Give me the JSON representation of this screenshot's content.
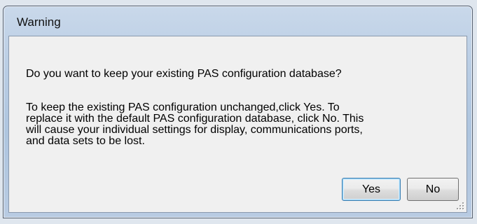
{
  "window": {
    "title": "Warning"
  },
  "dialog": {
    "question": "Do you want to keep your existing PAS configuration database?",
    "body_lines": [
      "To keep the existing PAS configuration unchanged,click Yes. To",
      "replace it with the default PAS configuration database, click No. This",
      "will cause your individual settings for display, communications ports,",
      "and data sets to be lost."
    ]
  },
  "buttons": {
    "yes_label": "Yes",
    "no_label": "No"
  },
  "icons": {
    "resize_grip": "resize-grip-icon"
  },
  "colors": {
    "title_bar": "#b9cde4",
    "dialog_background": "#f0f0f0",
    "default_button_border": "#3c7fb1"
  }
}
